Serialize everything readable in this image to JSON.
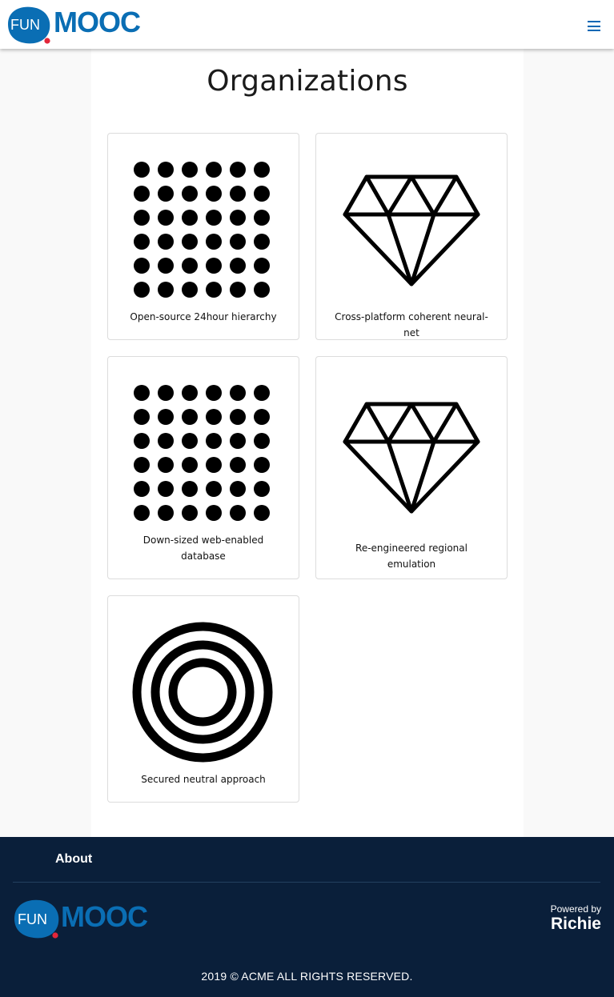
{
  "header": {
    "logo": {
      "left_text": "FUN",
      "right_text": "MOOC",
      "brand_color": "#0a6eb4",
      "dot_color": "#e2263a"
    },
    "menu_icon": "hamburger-menu-icon"
  },
  "main": {
    "title": "Organizations",
    "organizations": [
      {
        "name": "Open-source 24hour hierarchy",
        "icon": "dot-grid-icon"
      },
      {
        "name": "Cross-platform coherent neural-net",
        "icon": "diamond-icon"
      },
      {
        "name": "Down-sized web-enabled database",
        "icon": "dot-grid-icon"
      },
      {
        "name": "Re-engineered regional emulation",
        "icon": "diamond-icon"
      },
      {
        "name": "Secured neutral approach",
        "icon": "concentric-circles-icon"
      }
    ]
  },
  "footer": {
    "about_label": "About",
    "powered_by_label": "Powered by",
    "powered_by_name": "Richie",
    "copyright": "2019 © ACME ALL RIGHTS RESERVED.",
    "background_color": "#0a1f3a"
  }
}
